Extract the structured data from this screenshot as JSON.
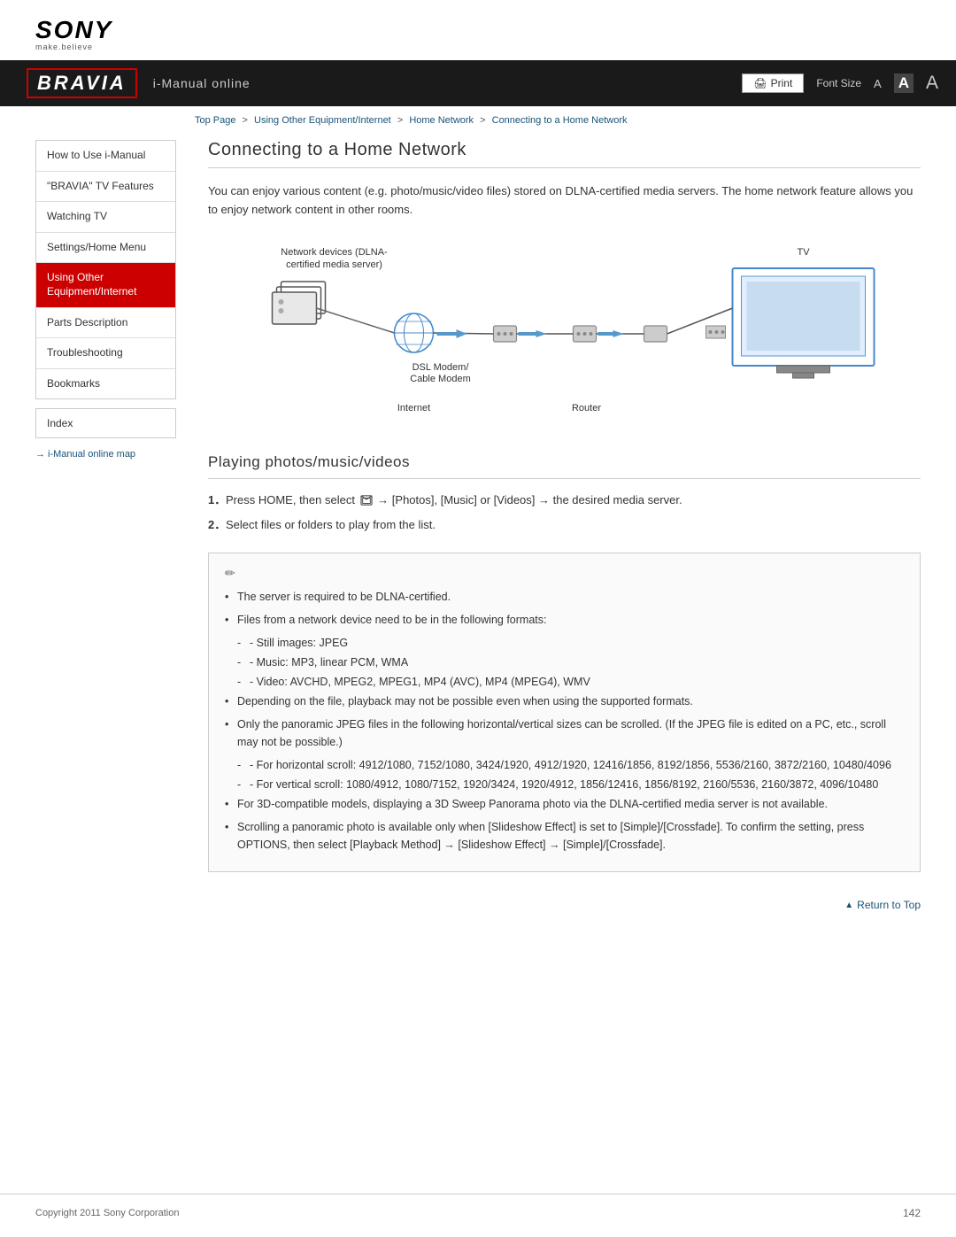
{
  "header": {
    "sony_text": "SONY",
    "sony_tagline": "make.believe",
    "bravia_label": "BRAVIA",
    "nav_title": "i-Manual online",
    "print_label": "Print",
    "font_size_label": "Font Size",
    "font_size_small": "A",
    "font_size_medium": "A",
    "font_size_large": "A"
  },
  "breadcrumb": {
    "top_page": "Top Page",
    "sep1": ">",
    "level2": "Using Other Equipment/Internet",
    "sep2": ">",
    "level3": "Home Network",
    "sep3": ">",
    "current": "Connecting to a Home Network"
  },
  "sidebar": {
    "items": [
      {
        "label": "How to Use i-Manual",
        "active": false
      },
      {
        "label": "\"BRAVIA\" TV Features",
        "active": false
      },
      {
        "label": "Watching TV",
        "active": false
      },
      {
        "label": "Settings/Home Menu",
        "active": false
      },
      {
        "label": "Using Other Equipment/Internet",
        "active": true
      },
      {
        "label": "Parts Description",
        "active": false
      },
      {
        "label": "Troubleshooting",
        "active": false
      },
      {
        "label": "Bookmarks",
        "active": false
      }
    ],
    "index_label": "Index",
    "map_link": "i-Manual online map"
  },
  "content": {
    "page_title": "Connecting to a Home Network",
    "intro": "You can enjoy various content (e.g. photo/music/video files) stored on DLNA-certified media servers. The home network feature allows you to enjoy network content in other rooms.",
    "diagram": {
      "label_network_devices": "Network devices (DLNA-\ncertified media server)",
      "label_dsl_modem": "DSL Modem/\nCable Modem",
      "label_internet": "Internet",
      "label_router": "Router",
      "label_tv": "TV"
    },
    "sub_title": "Playing photos/music/videos",
    "steps": [
      {
        "num": "1.",
        "text": "Press HOME, then select [home-icon] → [Photos], [Music] or [Videos] → the desired media server."
      },
      {
        "num": "2.",
        "text": "Select files or folders to play from the list."
      }
    ],
    "notes": [
      {
        "type": "bullet",
        "text": "The server is required to be DLNA-certified."
      },
      {
        "type": "bullet",
        "text": "Files from a network device need to be in the following formats:"
      },
      {
        "type": "sub",
        "text": "- Still images: JPEG"
      },
      {
        "type": "sub",
        "text": "- Music: MP3, linear PCM, WMA"
      },
      {
        "type": "sub",
        "text": "- Video: AVCHD, MPEG2, MPEG1, MP4 (AVC), MP4 (MPEG4), WMV"
      },
      {
        "type": "bullet",
        "text": "Depending on the file, playback may not be possible even when using the supported formats."
      },
      {
        "type": "bullet",
        "text": "Only the panoramic JPEG files in the following horizontal/vertical sizes can be scrolled. (If the JPEG file is edited on a PC, etc., scroll may not be possible.)"
      },
      {
        "type": "sub",
        "text": "- For horizontal scroll: 4912/1080, 7152/1080, 3424/1920, 4912/1920, 12416/1856, 8192/1856, 5536/2160, 3872/2160, 10480/4096"
      },
      {
        "type": "sub",
        "text": "- For vertical scroll: 1080/4912, 1080/7152, 1920/3424, 1920/4912, 1856/12416, 1856/8192, 2160/5536, 2160/3872, 4096/10480"
      },
      {
        "type": "bullet",
        "text": "For 3D-compatible models, displaying a 3D Sweep Panorama photo via the DLNA-certified media server is not available."
      },
      {
        "type": "bullet",
        "text": "Scrolling a panoramic photo is available only when [Slideshow Effect] is set to [Simple]/[Crossfade]. To confirm the setting, press OPTIONS, then select [Playback Method] → [Slideshow Effect] → [Simple]/[Crossfade]."
      }
    ]
  },
  "footer": {
    "copyright": "Copyright 2011 Sony Corporation",
    "page_number": "142",
    "return_to_top": "Return to Top"
  }
}
